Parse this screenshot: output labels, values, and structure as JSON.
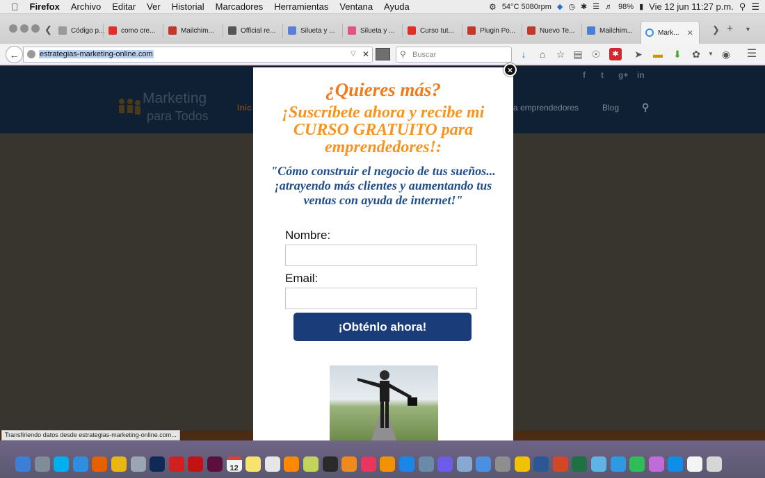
{
  "menubar": {
    "apple": "",
    "app": "Firefox",
    "items": [
      "Archivo",
      "Editar",
      "Ver",
      "Historial",
      "Marcadores",
      "Herramientas",
      "Ventana",
      "Ayuda"
    ],
    "status": {
      "temp": "54°C 5080rpm",
      "battery": "98%",
      "clock": "Vie 12 jun  11:27 p.m."
    }
  },
  "tabs": [
    {
      "label": "Código p...",
      "color": "#9a9a9a"
    },
    {
      "label": "como cre...",
      "color": "#e52d27"
    },
    {
      "label": "Mailchim...",
      "color": "#c0392b"
    },
    {
      "label": "Official re...",
      "color": "#555555"
    },
    {
      "label": "Silueta y ...",
      "color": "#5b7fd6"
    },
    {
      "label": "Silueta y ...",
      "color": "#e05585"
    },
    {
      "label": "Curso tut...",
      "color": "#e52d27"
    },
    {
      "label": "Plugin Po...",
      "color": "#c0392b"
    },
    {
      "label": "Nuevo Te...",
      "color": "#c0392b"
    },
    {
      "label": "Mailchim...",
      "color": "#4a7fd8"
    },
    {
      "label": "Mark...",
      "color": "#ffffff"
    }
  ],
  "navbar": {
    "url": "estrategias-marketing-online.com",
    "search_placeholder": "Buscar"
  },
  "site": {
    "logo_main": "Marketing",
    "logo_sub": "para Todos",
    "nav_start": "Inic",
    "nav_middle": "a emprendedores",
    "nav_blog": "Blog",
    "social": [
      "f",
      "t",
      "g+",
      "in"
    ]
  },
  "modal": {
    "heading": "¿Quieres más?",
    "subheading": "¡Suscríbete ahora y recibe mi CURSO GRATUITO para emprendedores!:",
    "quote": "\"Cómo construir el negocio de tus sueños... ¡atrayendo más clientes y aumentando tus ventas con ayuda de internet!\"",
    "name_label": "Nombre:",
    "email_label": "Email:",
    "submit_label": "¡Obténlo ahora!",
    "close": "×"
  },
  "statusbar": "Transfiriendo datos desde estrategias-marketing-online.com...",
  "dock": {
    "calendar_day": "12",
    "icons": [
      {
        "name": "finder",
        "color": "#3b7fd9"
      },
      {
        "name": "launchpad",
        "color": "#7f8c9a"
      },
      {
        "name": "skype",
        "color": "#00aff0"
      },
      {
        "name": "safari",
        "color": "#2d8fe0"
      },
      {
        "name": "firefox",
        "color": "#e66000"
      },
      {
        "name": "chrome",
        "color": "#e8b712"
      },
      {
        "name": "preview",
        "color": "#9aa6b1"
      },
      {
        "name": "photoshop",
        "color": "#0f2a57"
      },
      {
        "name": "acrobat",
        "color": "#d21f1f"
      },
      {
        "name": "acrobat-reader",
        "color": "#c21212"
      },
      {
        "name": "indesign",
        "color": "#5a0f3d"
      },
      {
        "name": "calendar",
        "color": "#f3f3f3"
      },
      {
        "name": "notes",
        "color": "#f8e46d"
      },
      {
        "name": "textedit",
        "color": "#e6e6e6"
      },
      {
        "name": "vlc",
        "color": "#ff8800"
      },
      {
        "name": "colorsync",
        "color": "#c2d45b"
      },
      {
        "name": "quicktime",
        "color": "#2a2a2a"
      },
      {
        "name": "amazon",
        "color": "#f08a1d"
      },
      {
        "name": "itunes",
        "color": "#e9365e"
      },
      {
        "name": "ibooks",
        "color": "#f39200"
      },
      {
        "name": "appstore",
        "color": "#1a86e8"
      },
      {
        "name": "migration",
        "color": "#6b8aa8"
      },
      {
        "name": "imovie",
        "color": "#6c5ce7"
      },
      {
        "name": "mail",
        "color": "#87a8d0"
      },
      {
        "name": "downloads",
        "color": "#4a90e2"
      },
      {
        "name": "system-prefs",
        "color": "#8e8e8e"
      },
      {
        "name": "burn",
        "color": "#f2c200"
      },
      {
        "name": "word",
        "color": "#2b5797"
      },
      {
        "name": "powerpoint",
        "color": "#d24726"
      },
      {
        "name": "excel",
        "color": "#1e7145"
      },
      {
        "name": "preview-2",
        "color": "#5fb3e6"
      },
      {
        "name": "file-transfer",
        "color": "#2d9be3"
      },
      {
        "name": "facetime",
        "color": "#2ebd59"
      },
      {
        "name": "screen-sharing",
        "color": "#c06bd8"
      },
      {
        "name": "teamviewer",
        "color": "#0e8ee9"
      },
      {
        "name": "documents-stack",
        "color": "#f4f4f4"
      },
      {
        "name": "trash",
        "color": "#d6d6d6"
      }
    ]
  }
}
